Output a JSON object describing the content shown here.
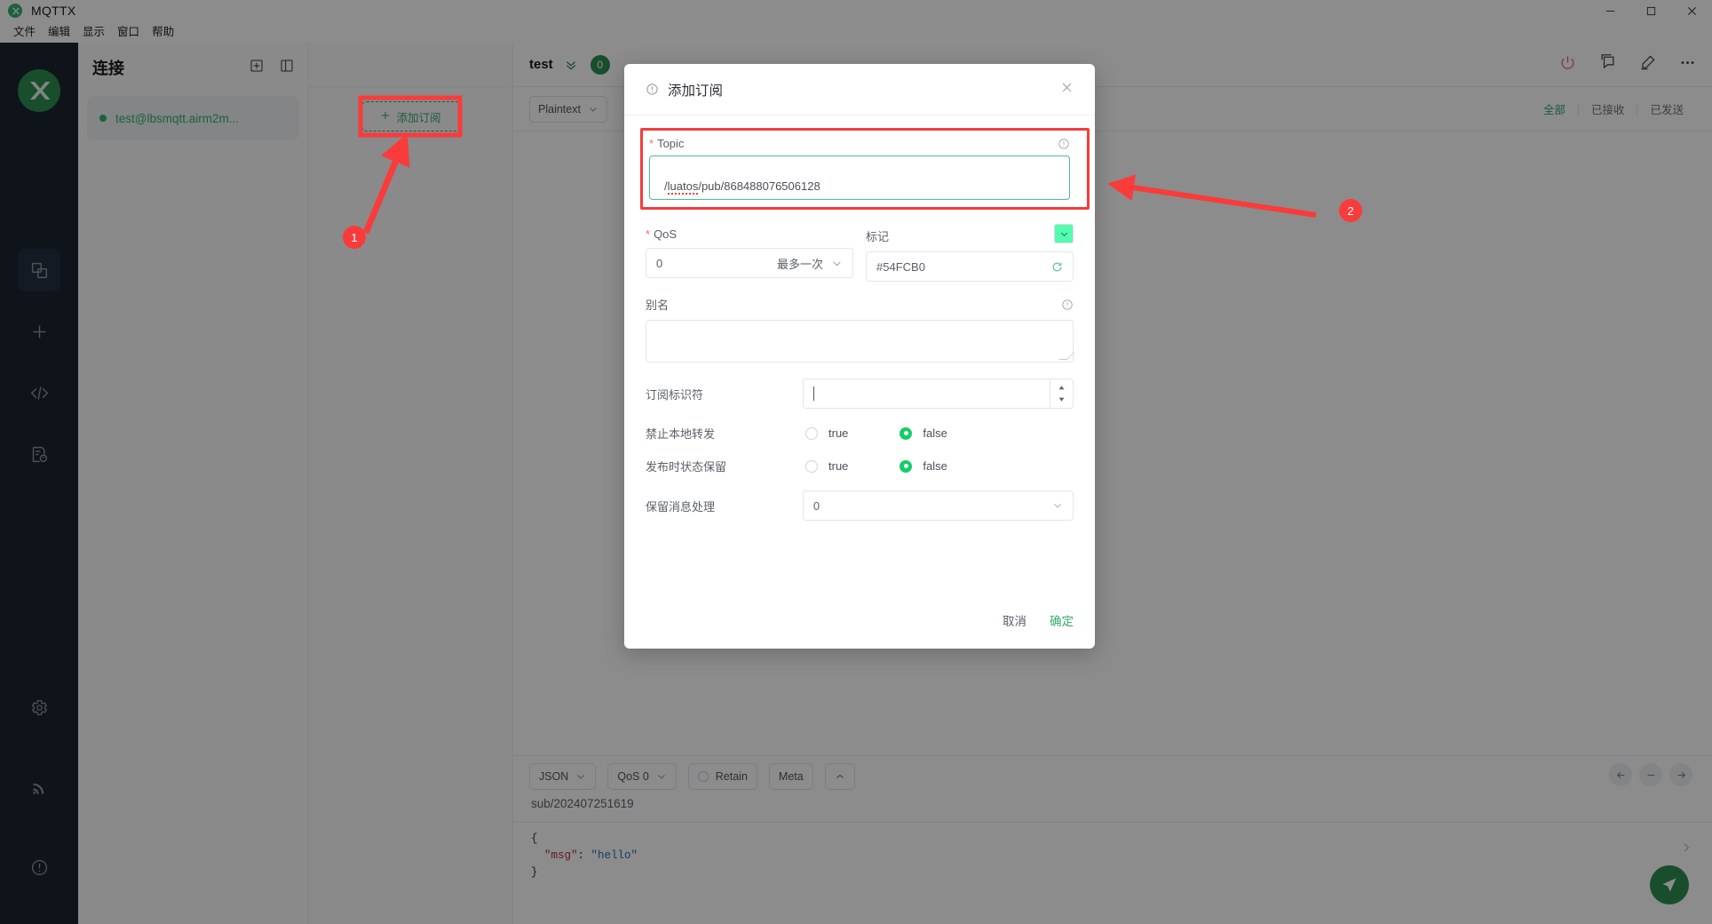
{
  "window": {
    "app_title": "MQTTX",
    "controls": {
      "minimize": "minimize-icon",
      "maximize": "maximize-icon",
      "close": "close-icon"
    }
  },
  "menubar": {
    "items": [
      "文件",
      "编辑",
      "显示",
      "窗口",
      "帮助"
    ]
  },
  "rail": {
    "logo": "mqttx-logo",
    "icons": [
      {
        "name": "connections-icon",
        "active": true
      },
      {
        "name": "new-connection-plus-icon",
        "active": false
      },
      {
        "name": "code-brackets-icon",
        "active": false
      },
      {
        "name": "script-log-icon",
        "active": false
      }
    ],
    "bottom_icons": [
      {
        "name": "settings-gear-icon"
      },
      {
        "name": "signal-broadcast-icon"
      },
      {
        "name": "info-circle-icon"
      }
    ]
  },
  "connections": {
    "title": "连接",
    "actions": [
      "add-connection-icon",
      "toggle-panel-icon"
    ],
    "items": [
      {
        "label": "test@lbsmqtt.airm2m...",
        "status": "connected"
      }
    ]
  },
  "subscriptions": {
    "add_button_label": "添加订阅",
    "add_button_icon": "plus-icon"
  },
  "main": {
    "tab_name": "test",
    "tab_badge": "0",
    "chevron_icon": "double-chevron-down-icon",
    "toolbar_icons": [
      "power-icon",
      "message-icon",
      "edit-pencil-icon",
      "more-dots-icon"
    ],
    "format_select": "Plaintext",
    "filters": [
      {
        "label": "全部",
        "active": true
      },
      {
        "label": "已接收",
        "active": false
      },
      {
        "label": "已发送",
        "active": false
      }
    ]
  },
  "composer": {
    "format": "JSON",
    "qos": "QoS 0",
    "retain_label": "Retain",
    "meta_label": "Meta",
    "collapse_icon": "chevron-up-icon",
    "topic": "sub/202407251619",
    "payload_lines": [
      {
        "text": "{",
        "type": "plain"
      },
      {
        "key": "\"msg\"",
        "sep": ": ",
        "value": "\"hello\"",
        "type": "pair"
      },
      {
        "text": "}",
        "type": "plain"
      }
    ],
    "nav_buttons": [
      "arrow-left-icon",
      "minus-icon",
      "arrow-right-icon"
    ],
    "send_icon": "send-paper-plane-icon"
  },
  "dialog": {
    "title": "添加订阅",
    "title_icon": "info-circle-icon",
    "close_icon": "close-icon",
    "topic": {
      "label": "Topic",
      "required": true,
      "info_icon": "info-circle-icon",
      "value": "/luatos/pub/868488076506128",
      "value_spell_part": "luatos",
      "value_rest": "/pub/868488076506128",
      "value_prefix": "/"
    },
    "qos": {
      "label": "QoS",
      "required": true,
      "value": "0",
      "value_text": "最多一次",
      "chevron_icon": "chevron-down-icon"
    },
    "tag": {
      "label": "标记",
      "value": "#54FCB0",
      "color": "#54FCB0",
      "refresh_icon": "refresh-icon",
      "swatch_icon": "chevron-down-icon"
    },
    "alias": {
      "label": "别名",
      "value": "",
      "info_icon": "info-circle-icon"
    },
    "sub_identifier": {
      "label": "订阅标识符",
      "value": "",
      "spinner_up_icon": "caret-up-icon",
      "spinner_down_icon": "caret-down-icon"
    },
    "no_local": {
      "label": "禁止本地转发",
      "options": [
        "true",
        "false"
      ],
      "selected": "false"
    },
    "retain_as_published": {
      "label": "发布时状态保留",
      "options": [
        "true",
        "false"
      ],
      "selected": "false"
    },
    "retain_handling": {
      "label": "保留消息处理",
      "value": "0",
      "chevron_icon": "chevron-down-icon"
    },
    "cancel_label": "取消",
    "confirm_label": "确定"
  },
  "annotations": {
    "marker_1": "1",
    "marker_2": "2",
    "accent_color": "#f93b3b"
  }
}
